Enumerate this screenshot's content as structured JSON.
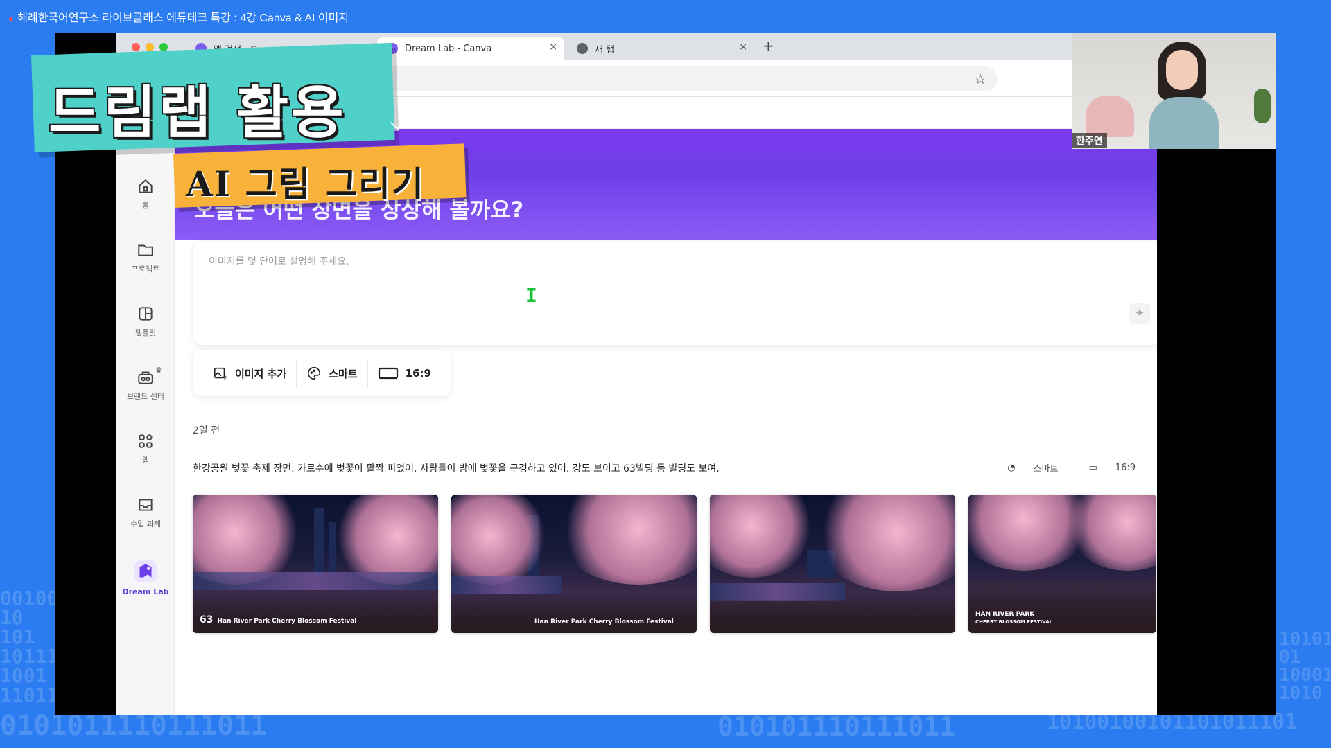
{
  "video_title": "해례한국어연구소 라이브클래스 에듀테크 특강 : 4강 Canva & AI 이미지",
  "browser": {
    "tabs": [
      {
        "label": "앱 검색 - Canva"
      },
      {
        "label": "Dream Lab - Canva"
      },
      {
        "label": "새 탭"
      }
    ]
  },
  "sidebar": {
    "items": [
      {
        "label": "홈",
        "icon": "home-icon"
      },
      {
        "label": "프로젝트",
        "icon": "folder-icon"
      },
      {
        "label": "템플릿",
        "icon": "template-icon"
      },
      {
        "label": "브랜드 센터",
        "icon": "brand-icon"
      },
      {
        "label": "앱",
        "icon": "apps-icon"
      },
      {
        "label": "수업 과제",
        "icon": "inbox-icon"
      },
      {
        "label": "Dream Lab",
        "icon": "dream-lab-icon"
      }
    ]
  },
  "hero": {
    "title": "오늘은 어떤 장면을 상상해 볼까요?"
  },
  "prompt": {
    "placeholder": "이미지를 몇 단어로 설명해 주세요."
  },
  "options": {
    "add_image": "이미지 추가",
    "style": "스마트",
    "ratio": "16:9"
  },
  "history": {
    "date": "2일 전",
    "prompt": "한강공원 벚꽃 축제 장면. 가로수에 벚꽃이 활짝 피었어. 사람들이 밤에 벚꽃을 구경하고 있어. 강도 보이고 63빌딩 등 빌딩도 보여.",
    "style": "스마트",
    "ratio": "16:9",
    "images": [
      {
        "caption_main": "Han River Park Cherry Blossom Festival",
        "badge": "63"
      },
      {
        "caption_main": "Han River Park Cherry Blossom Festival",
        "badge": ""
      },
      {
        "caption_main": "",
        "badge": ""
      },
      {
        "caption_main": "HAN RIVER PARK",
        "caption_sub": "CHERRY BLOSSOM FESTIVAL",
        "badge": ""
      }
    ]
  },
  "webcam": {
    "name": "한주연"
  },
  "overlay": {
    "title": "드림랩 활용",
    "subtitle": "AI 그림 그리기"
  },
  "colors": {
    "background": "#2b7cf0",
    "hero": "#7c3aed",
    "banner_primary": "#4fd0c8",
    "banner_secondary": "#f8b23a",
    "cursor": "#19c135"
  }
}
